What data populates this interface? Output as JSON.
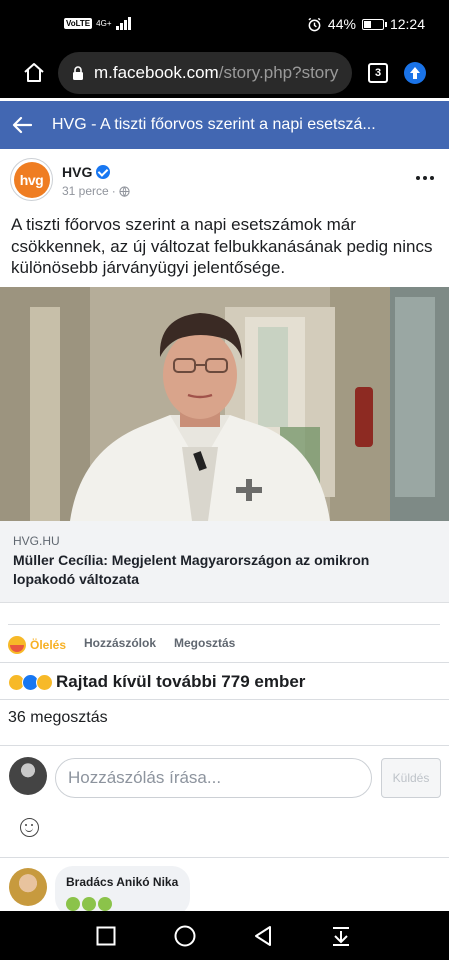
{
  "status_bar": {
    "volte": "VoLTE",
    "network": "4G+",
    "battery": "44%",
    "battery_fraction": 0.44,
    "time": "12:24"
  },
  "browser": {
    "url_host": "m.facebook.com",
    "url_path": "/story.php?story",
    "tab_count": "3",
    "icons": [
      "home-icon",
      "lock-icon",
      "tabs-icon",
      "update-icon"
    ]
  },
  "header": {
    "title": "HVG - A tiszti főorvos szerint a napi esetszá...",
    "icons": [
      "back-arrow-icon"
    ]
  },
  "post": {
    "avatar_text": "hvg",
    "page_name": "HVG",
    "time": "31 perce",
    "time_separator": "·",
    "text": "A tiszti főorvos szerint a napi esetszámok már csökkennek, az új változat felbukkanásának pedig nincs különösebb járványügyi jelentősége.",
    "link_domain": "HVG.HU",
    "link_title": "Müller Cecília: Megjelent Magyarországon az omikron lopakodó változata"
  },
  "actions": {
    "reaction_label": "Ölelés",
    "comments_label": "Hozzászólok",
    "share_label": "Megosztás"
  },
  "reactions_summary": {
    "text": "Rajtad kívül további 779 ember",
    "shares": "36 megosztás"
  },
  "comment_box": {
    "placeholder": "Hozzászólás írása...",
    "send_label": "Küldés"
  },
  "comments": [
    {
      "author": "Bradács Anikó Nika"
    }
  ],
  "colors": {
    "facebook_blue": "#4267b2",
    "hug_yellow": "#f7b125",
    "hvg_orange": "#ef7d22"
  }
}
